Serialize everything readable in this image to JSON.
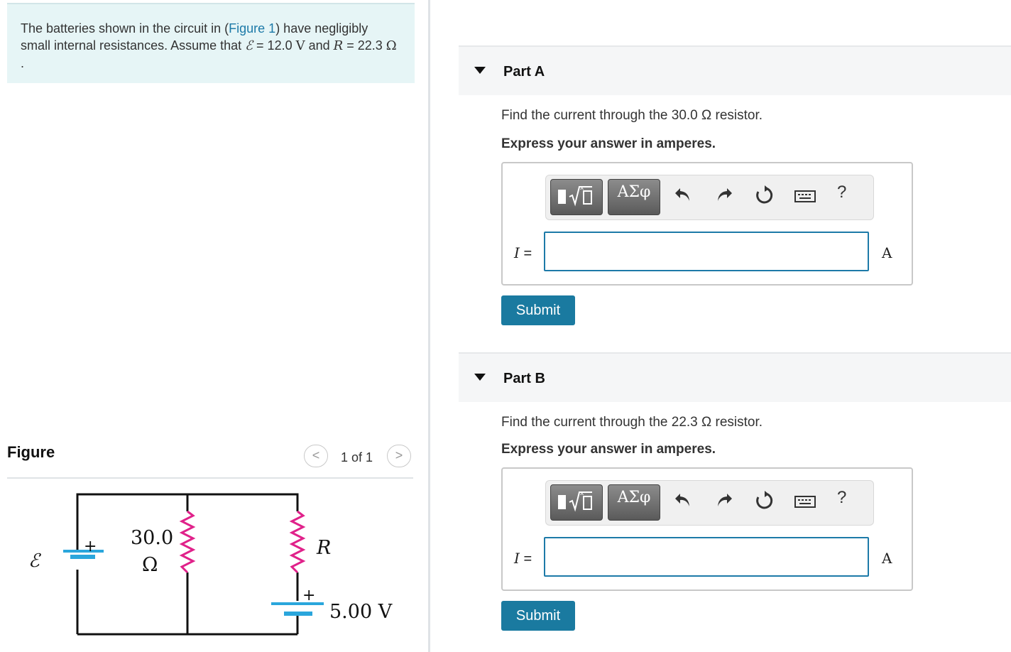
{
  "problem": {
    "text_before": "The batteries shown in the circuit in (",
    "figure_link": "Figure 1",
    "text_after": ") have negligibly small internal resistances. Assume that ",
    "emf_symbol": "ℰ",
    "emf_value": " = 12.0 ",
    "emf_unit": "V",
    "and_text": " and ",
    "r_symbol": "R",
    "r_value": " = 22.3 ",
    "r_unit": "Ω",
    "end": " ."
  },
  "figure": {
    "title": "Figure",
    "pager": "1 of 1",
    "prev_glyph": "<",
    "next_glyph": ">",
    "labels": {
      "emf": "ℰ",
      "resistor_value": "30.0",
      "resistor_unit": "Ω",
      "r": "R",
      "battery2": "5.00 V",
      "plus": "+"
    },
    "colors": {
      "resistor": "#e0218a",
      "battery_plate": "#2aa6dc",
      "wire": "#111111"
    }
  },
  "parts": [
    {
      "title": "Part A",
      "question": "Find the current through the 30.0 Ω resistor.",
      "instruction": "Express your answer in amperes.",
      "toolbar": {
        "greek": "ΑΣφ",
        "help": "?"
      },
      "variable": "I",
      "equals": " =",
      "input_value": "",
      "unit": "A",
      "submit": "Submit"
    },
    {
      "title": "Part B",
      "question": "Find the current through the 22.3 Ω resistor.",
      "instruction": "Express your answer in amperes.",
      "toolbar": {
        "greek": "ΑΣφ",
        "help": "?"
      },
      "variable": "I",
      "equals": " =",
      "input_value": "",
      "unit": "A",
      "submit": "Submit"
    }
  ],
  "colors": {
    "accent": "#1a7aa0",
    "problem_bg": "#e6f5f6",
    "link": "#1d7aa8"
  }
}
